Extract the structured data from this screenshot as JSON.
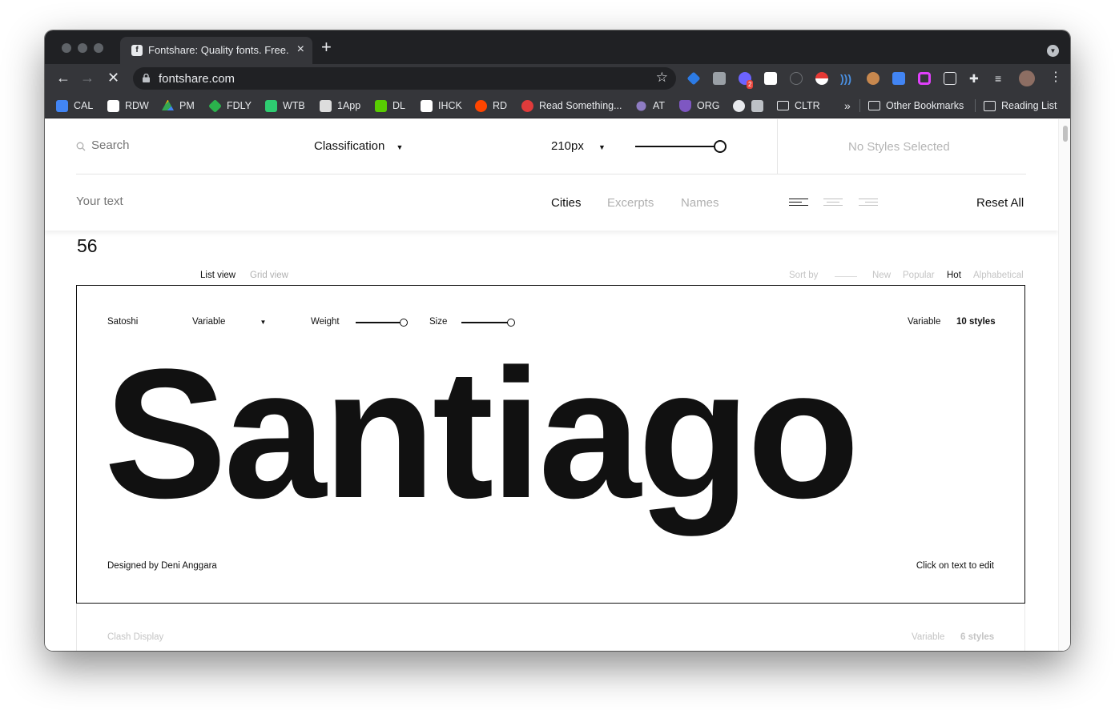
{
  "browser": {
    "tab_title": "Fontshare: Quality fonts. Free.",
    "tab_close": "×",
    "new_tab": "+",
    "url": "fontshare.com",
    "bookmarks": [
      {
        "label": "CAL",
        "color": "#4285f4"
      },
      {
        "label": "RDW",
        "color": "#ffffff"
      },
      {
        "label": "PM",
        "color": "#34a853"
      },
      {
        "label": "FDLY",
        "color": "#2bb24c"
      },
      {
        "label": "WTB",
        "color": "#2ecc71"
      },
      {
        "label": "1App",
        "color": "#dddddd"
      },
      {
        "label": "DL",
        "color": "#58cc02"
      },
      {
        "label": "IHCK",
        "color": "#ffffff"
      },
      {
        "label": "RD",
        "color": "#ff4500"
      },
      {
        "label": "Read Something...",
        "color": "#e03b3b"
      },
      {
        "label": "AT",
        "color": "#8e7cc3"
      },
      {
        "label": "ORG",
        "color": "#7e57c2"
      },
      {
        "label": "CLTR",
        "color": "#bdc1c6"
      }
    ],
    "more_bookmarks": "»",
    "other_bookmarks": "Other Bookmarks",
    "reading_list": "Reading List",
    "extension_badge": "2"
  },
  "filters": {
    "search_placeholder": "Search",
    "classification_label": "Classification",
    "size_label": "210px",
    "size_level": 1.0,
    "no_styles": "No Styles Selected",
    "text_placeholder": "Your text",
    "sample_tabs": [
      "Cities",
      "Excerpts",
      "Names"
    ],
    "active_sample_tab": "Cities",
    "reset_all": "Reset All"
  },
  "results": {
    "count": "56",
    "view_list": "List view",
    "view_grid": "Grid view",
    "sort_by_label": "Sort by",
    "sort_options": [
      "New",
      "Popular",
      "Hot",
      "Alphabetical"
    ],
    "active_sort": "Hot"
  },
  "font_card": {
    "name": "Satoshi",
    "style_select": "Variable",
    "weight_label": "Weight",
    "weight_level": 1.0,
    "size_label": "Size",
    "size_level": 1.0,
    "type_label": "Variable",
    "styles_count": "10 styles",
    "specimen_text": "Santiago",
    "designer": "Designed by Deni Anggara",
    "edit_hint": "Click on text to edit"
  },
  "next_card": {
    "name": "Clash Display",
    "type_label": "Variable",
    "styles_count": "6 styles"
  }
}
